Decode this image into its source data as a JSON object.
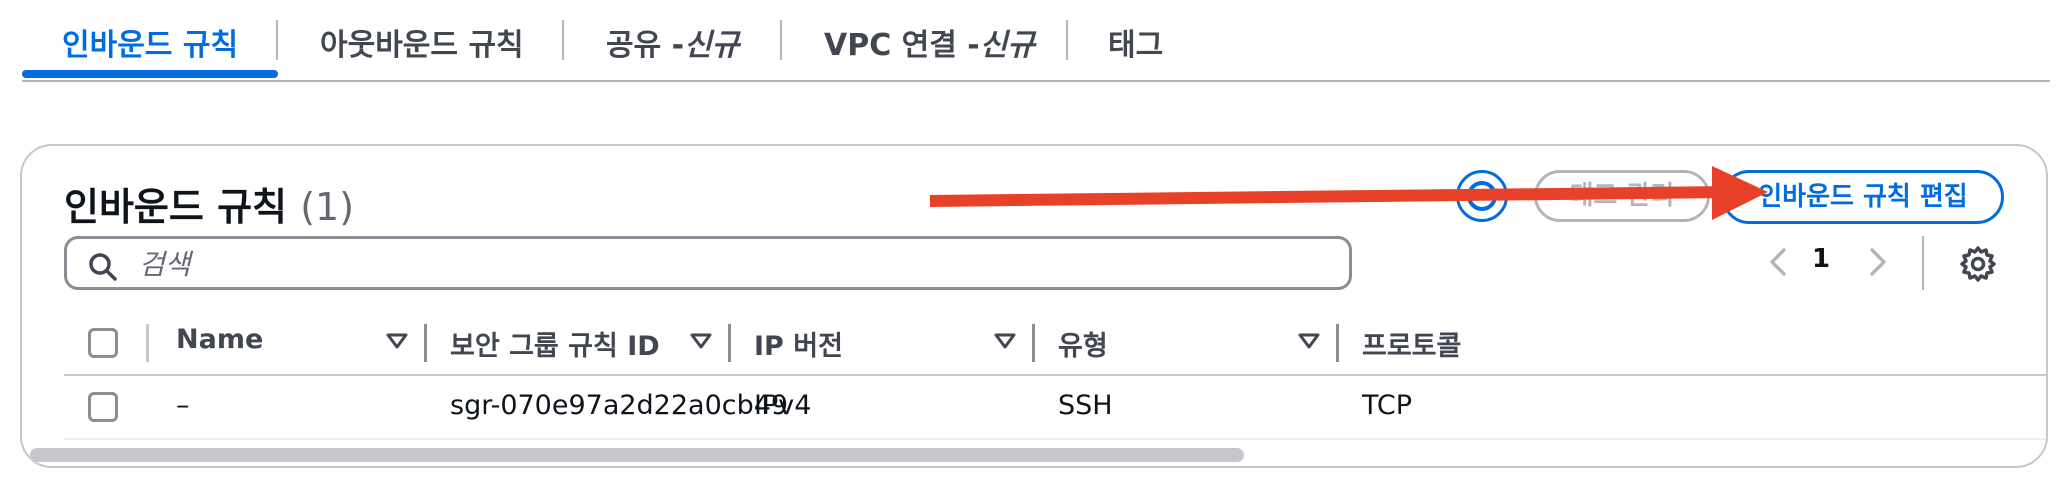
{
  "tabs": [
    {
      "label": "인바운드 규칙"
    },
    {
      "label": "아웃바운드 규칙"
    },
    {
      "label": "공유 -",
      "new": "신규"
    },
    {
      "label": "VPC 연결 -",
      "new": "신규"
    },
    {
      "label": "태그"
    }
  ],
  "panel": {
    "title": "인바운드 규칙",
    "count": "(1)",
    "tag_button": "태그 관리",
    "edit_button": "인바운드 규칙 편집"
  },
  "search": {
    "placeholder": "검색"
  },
  "pagination": {
    "page": "1"
  },
  "table": {
    "columns": [
      "Name",
      "보안 그룹 규칙 ID",
      "IP 버전",
      "유형",
      "프로토콜"
    ],
    "rows": [
      {
        "name": "–",
        "rule_id": "sgr-070e97a2d22a0cb49",
        "ip_version": "IPv4",
        "type": "SSH",
        "protocol": "TCP"
      }
    ]
  },
  "colors": {
    "accent": "#006ce0",
    "annotation_arrow": "#e8412a"
  }
}
